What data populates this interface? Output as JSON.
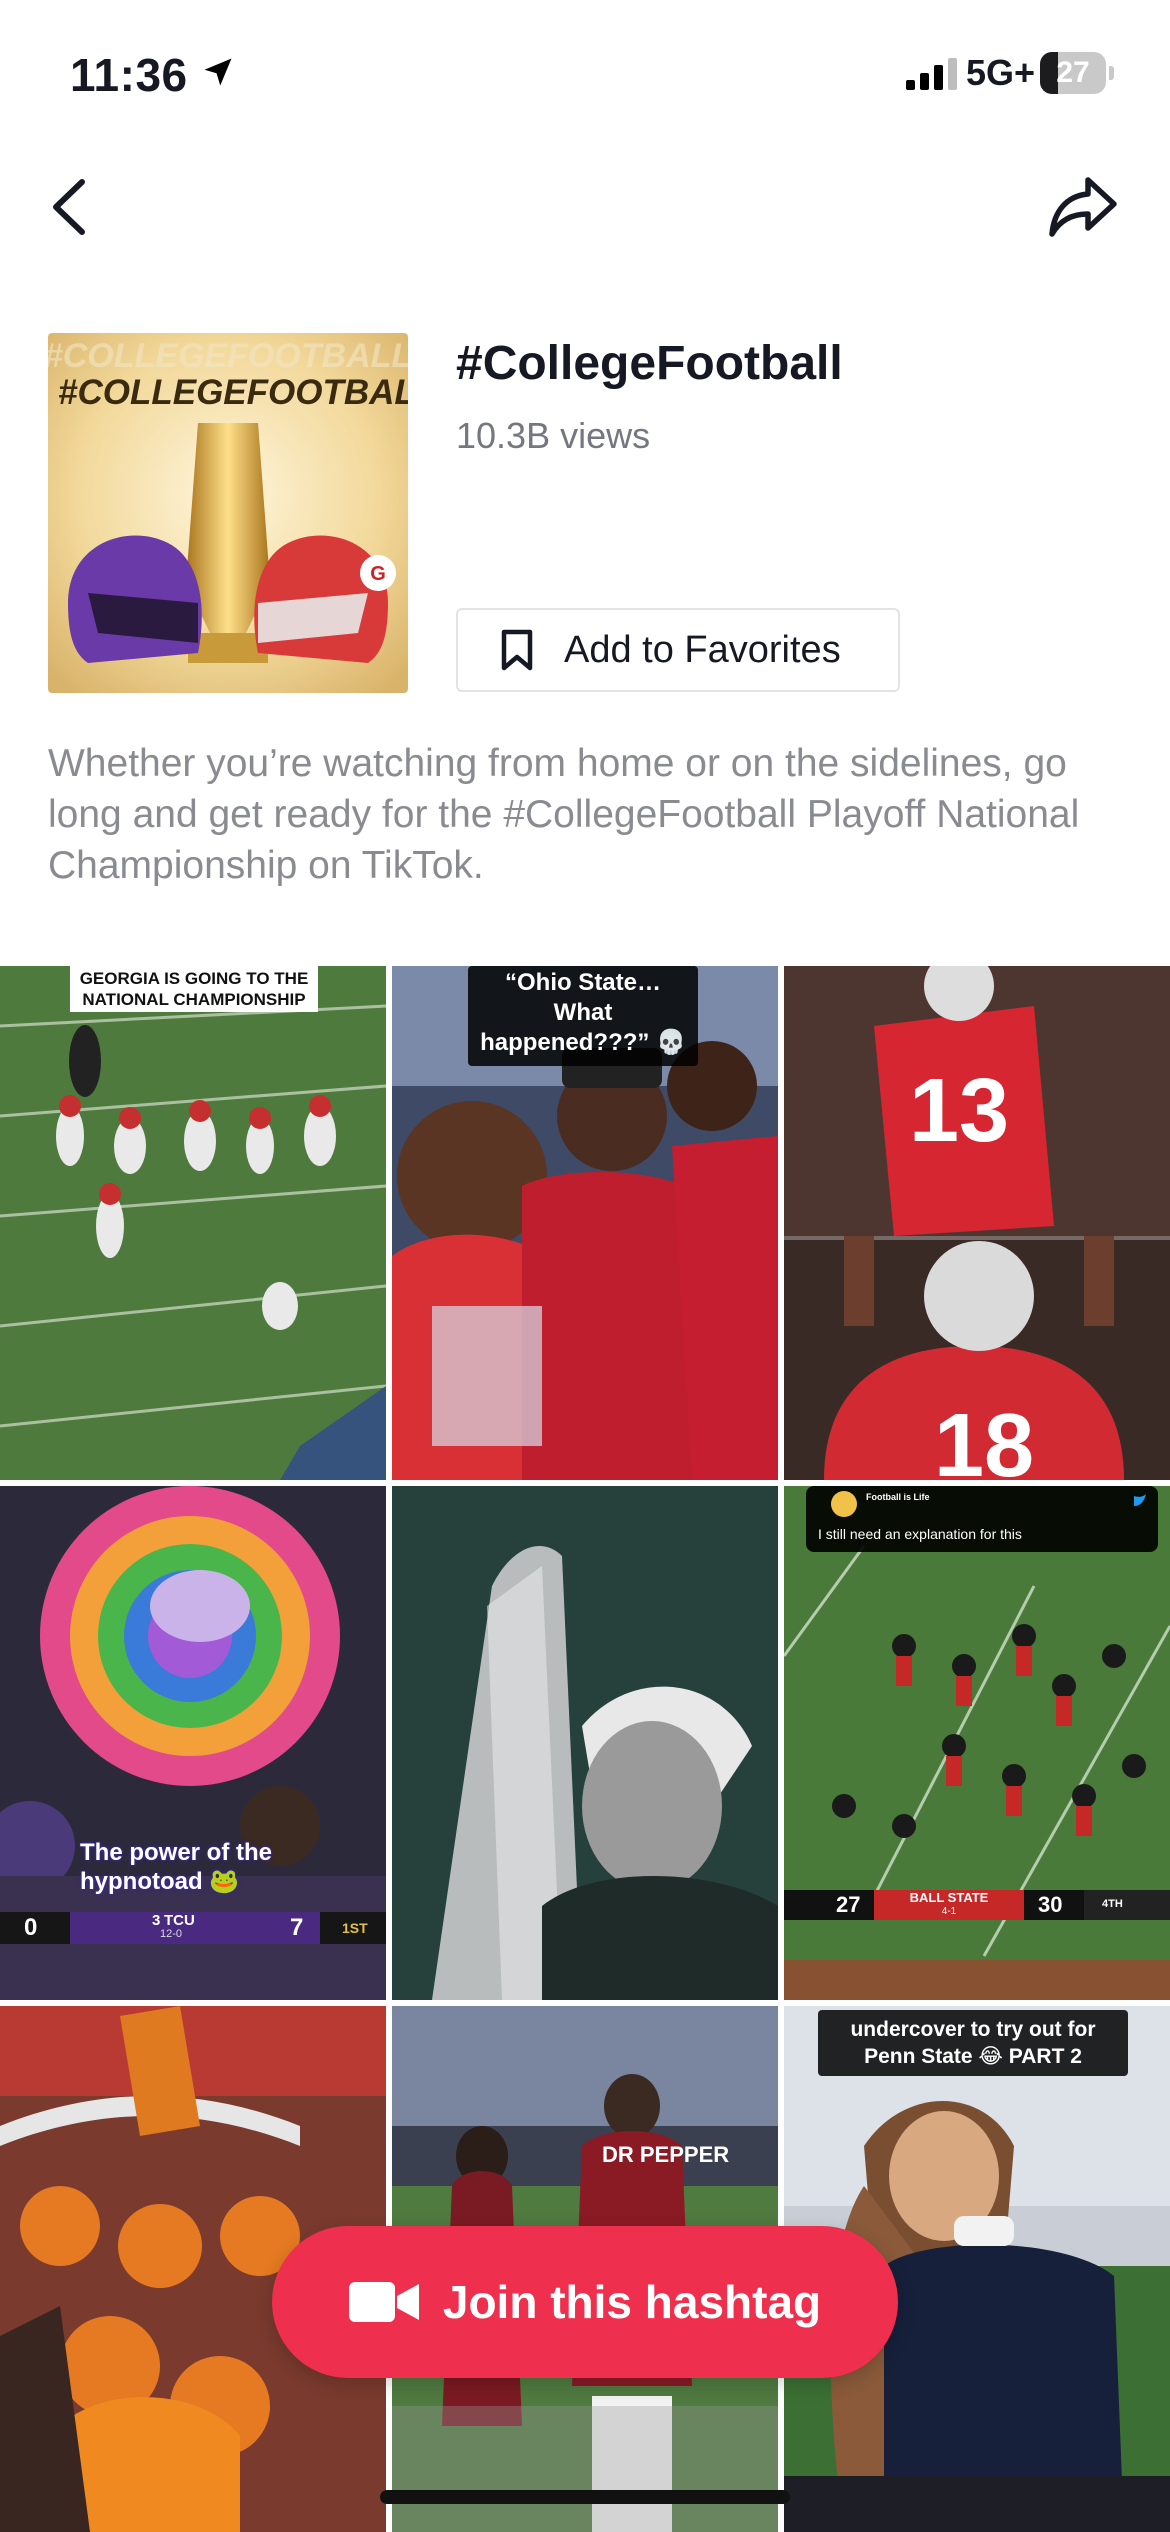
{
  "status_bar": {
    "time": "11:36",
    "network": "5G+",
    "battery_level": "27",
    "battery_fraction": 0.27,
    "icons": [
      "location-arrow-icon",
      "cellular-signal-icon",
      "battery-icon"
    ]
  },
  "nav": {
    "back_icon": "chevron-left-icon",
    "share_icon": "share-arrow-icon"
  },
  "header": {
    "cover_text": "#COLLEGEFOOTBALL",
    "title": "#CollegeFootball",
    "views": "10.3B views",
    "favorites_label": "Add to Favorites",
    "favorites_icon": "bookmark-icon",
    "description": "Whether you’re watching from home or on the sidelines, go long and get ready for the #CollegeFootball Playoff National Championship on TikTok."
  },
  "videos": [
    {
      "caption": "GEORGIA IS GOING TO THE NATIONAL CHAMPIONSHIP"
    },
    {
      "caption": "“Ohio State…What happened???” 💀"
    },
    {
      "caption": ""
    },
    {
      "caption": "The power of the hypnotoad 🐸",
      "score": {
        "left": "0",
        "team": "TCU",
        "seed": "3",
        "record": "12-0",
        "right": "7",
        "quarter": "1ST"
      }
    },
    {
      "caption": ""
    },
    {
      "caption": "I still need an explanation for this",
      "source": "Football is Life",
      "score": {
        "left": "27",
        "team": "BALL STATE",
        "record": "4-1",
        "right": "30",
        "quarter": "4TH"
      }
    },
    {
      "caption": ""
    },
    {
      "caption": "DR PEPPER"
    },
    {
      "caption": "undercover to try out for Penn State 😂 PART 2"
    }
  ],
  "join_button": {
    "label": "Join this hashtag",
    "icon": "video-camera-icon"
  },
  "colors": {
    "accent": "#ee2f4e",
    "text_primary": "#161823",
    "text_secondary": "#8a8b91"
  }
}
